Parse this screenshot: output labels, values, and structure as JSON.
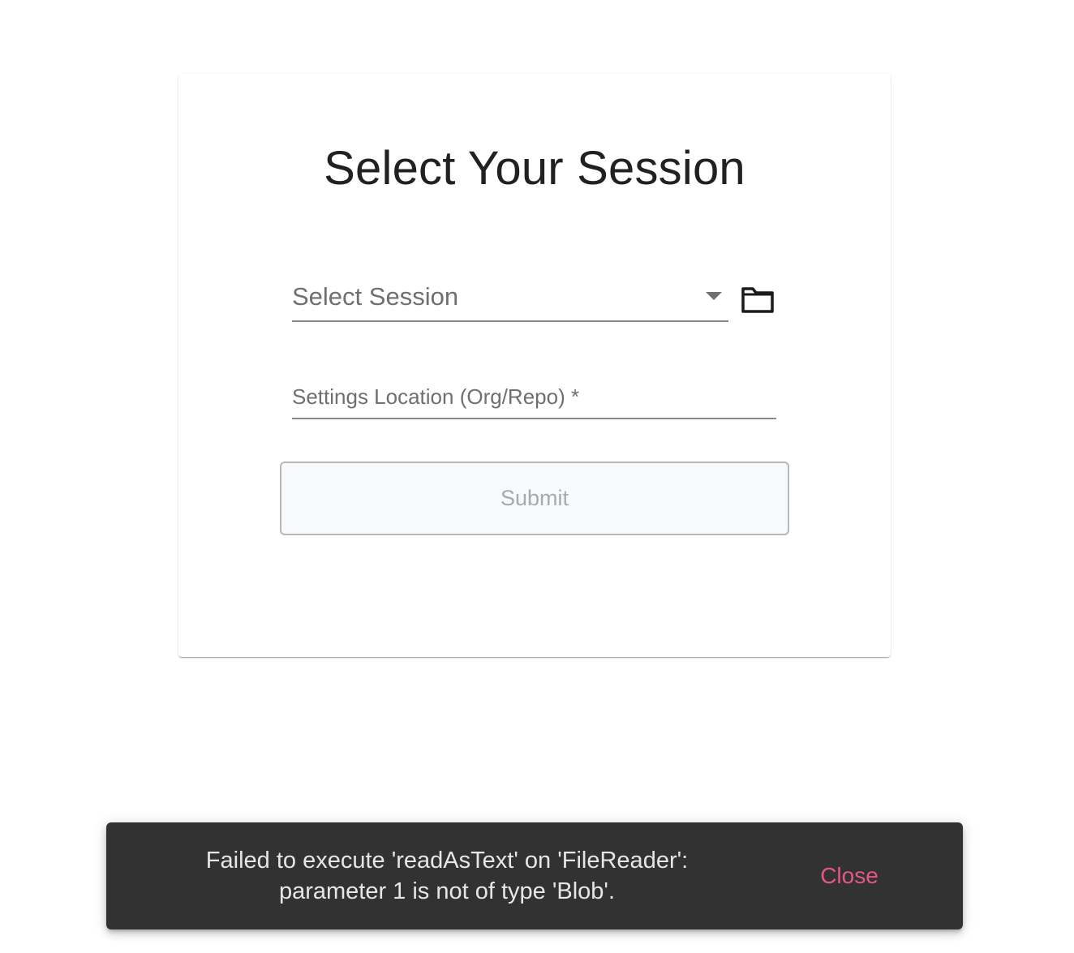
{
  "page": {
    "title": "Select Your Session"
  },
  "session_select": {
    "label": "Select Session",
    "selected_value": ""
  },
  "folder_button": {
    "icon": "folder-icon"
  },
  "settings_location": {
    "placeholder": "Settings Location (Org/Repo) *",
    "value": ""
  },
  "submit": {
    "label": "Submit",
    "disabled": true
  },
  "snackbar": {
    "message_line1": "Failed to execute 'readAsText' on 'FileReader':",
    "message_line2": "parameter 1 is not of type 'Blob'.",
    "close_label": "Close"
  },
  "colors": {
    "snackbar_bg": "#323232",
    "close_accent": "#e5568a",
    "submit_bg": "#f6fafd"
  }
}
